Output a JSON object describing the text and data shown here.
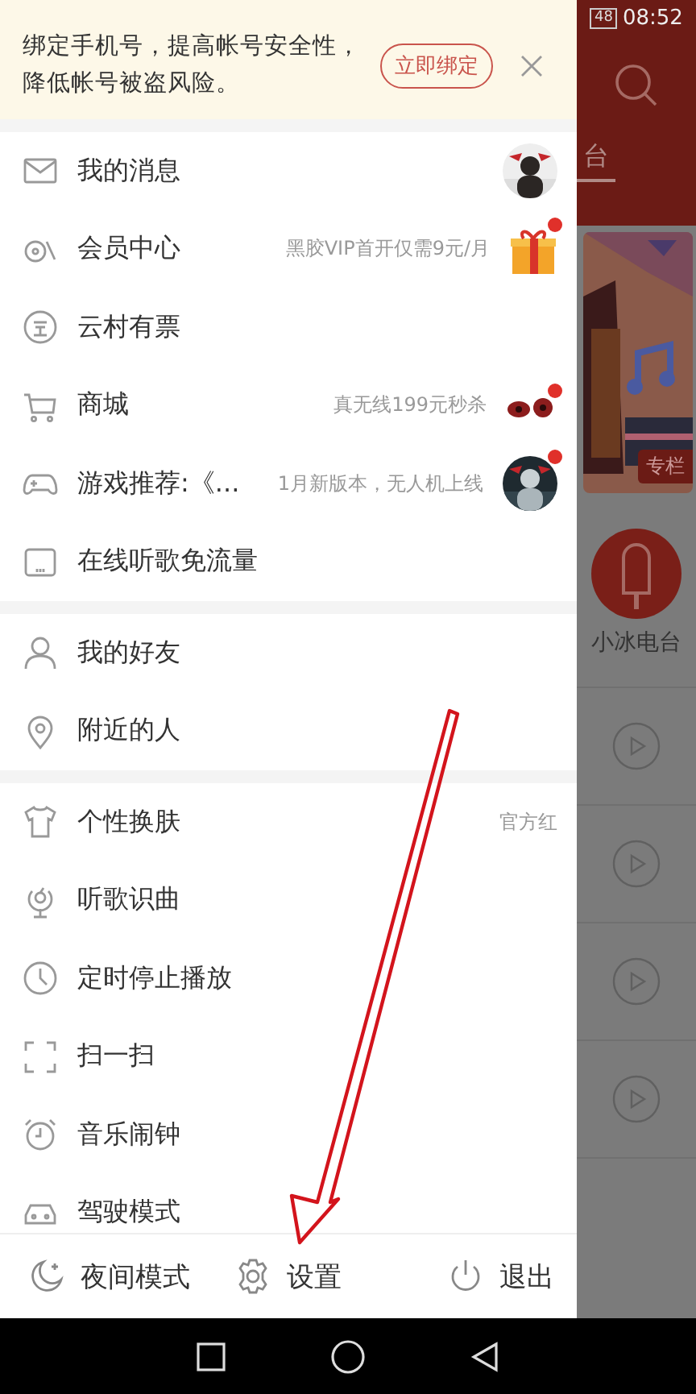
{
  "banner": {
    "text": "绑定手机号，提高帐号安全性，降低帐号被盗风险。",
    "button": "立即绑定"
  },
  "menu_groups": [
    {
      "items": [
        {
          "kind": "mail",
          "label": "我的消息",
          "dot": false
        },
        {
          "kind": "vip",
          "label": "会员中心",
          "detail": "黑胶VIP首开仅需9元/月",
          "thumb": {
            "kind": "gift"
          },
          "dot": true
        },
        {
          "kind": "ticket",
          "label": "云村有票",
          "dot": false
        },
        {
          "kind": "cart",
          "label": "商城",
          "detail": "真无线199元秒杀",
          "thumb": {
            "kind": "earbuds"
          },
          "dot": true
        },
        {
          "kind": "gamepad",
          "label": "游戏推荐:《...",
          "detail": "1月新版本，无人机上线",
          "dot": true
        },
        {
          "kind": "sim",
          "label": "在线听歌免流量",
          "dot": false
        }
      ]
    },
    {
      "items": [
        {
          "kind": "person",
          "label": "我的好友",
          "dot": false
        },
        {
          "kind": "location",
          "label": "附近的人",
          "dot": false
        }
      ]
    },
    {
      "items": [
        {
          "kind": "shirt",
          "label": "个性换肤",
          "detail": "官方红",
          "dot": false
        },
        {
          "kind": "mic",
          "label": "听歌识曲",
          "dot": false
        },
        {
          "kind": "clock",
          "label": "定时停止播放",
          "dot": false
        },
        {
          "kind": "scan",
          "label": "扫一扫",
          "dot": false
        },
        {
          "kind": "alarm",
          "label": "音乐闹钟",
          "dot": false
        },
        {
          "kind": "car",
          "label": "驾驶模式",
          "dot": false
        }
      ]
    }
  ],
  "bottom_bar": [
    {
      "kind": "moon",
      "label": "夜间模式"
    },
    {
      "kind": "gear",
      "label": "设置"
    },
    {
      "kind": "power",
      "label": "退出"
    }
  ],
  "status_bar": {
    "battery": "48",
    "time": "08:52"
  },
  "background": {
    "tab": "台",
    "tile_tag": "专栏",
    "station": "小冰电台"
  }
}
